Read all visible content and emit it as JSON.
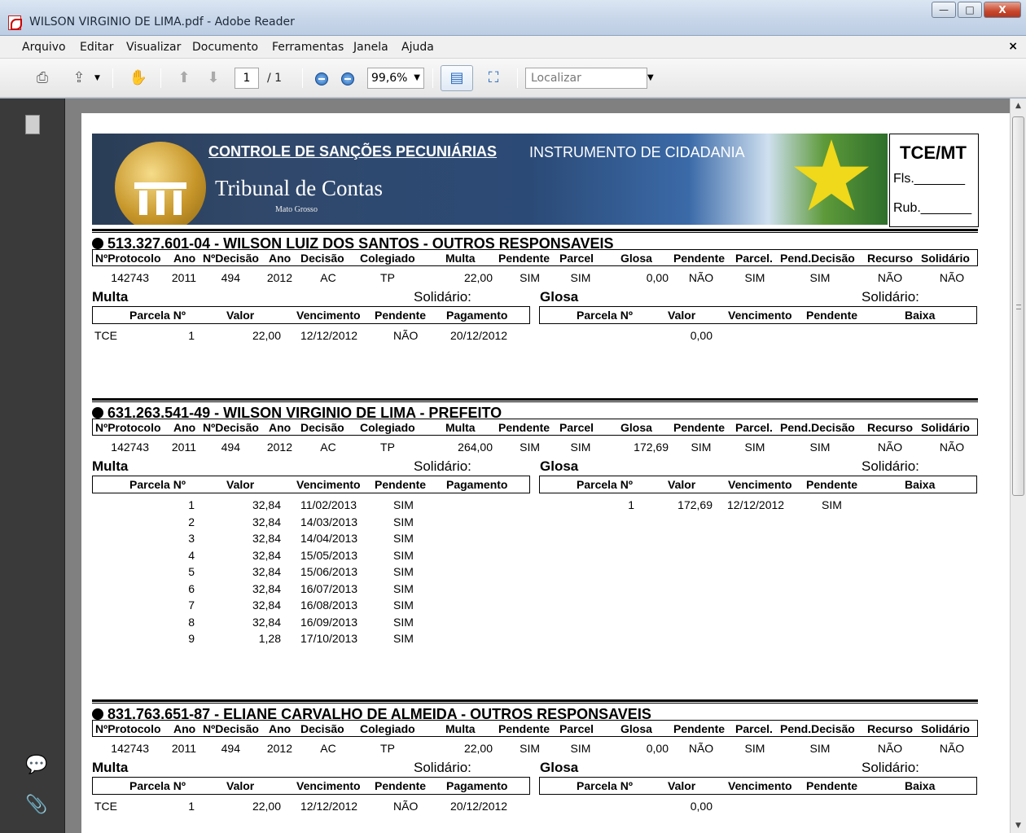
{
  "window": {
    "title": "WILSON VIRGINIO DE LIMA.pdf - Adobe Reader",
    "minimize": "—",
    "maximize": "□",
    "close": "X"
  },
  "menu": [
    "Arquivo",
    "Editar",
    "Visualizar",
    "Documento",
    "Ferramentas",
    "Janela",
    "Ajuda"
  ],
  "menu_close": "×",
  "toolbar": {
    "page_current": "1",
    "page_total": "/ 1",
    "zoom": "99,6%",
    "search_placeholder": "Localizar"
  },
  "banner": {
    "title_underlined": "CONTROLE DE SANÇÕES PECUNIÁRIAS",
    "title_rest": "INSTRUMENTO DE CIDADANIA",
    "org": "Tribunal de Contas",
    "state": "Mato Grosso",
    "box_title": "TCE/MT",
    "box_fls": "Fls._______",
    "box_rub": "Rub._______"
  },
  "labels": {
    "header": [
      "NºProtocolo",
      "Ano",
      "NºDecisão",
      "Ano",
      "Decisão",
      "Colegiado",
      "Multa",
      "Pendente",
      "Parcel",
      "Glosa",
      "Pendente",
      "Parcel.",
      "Pend.Decisão",
      "Recurso",
      "Solidário"
    ],
    "multa": "Multa",
    "glosa": "Glosa",
    "solidario": "Solidário:",
    "multa_sub": [
      "Parcela Nº",
      "Valor",
      "Vencimento",
      "Pendente",
      "Pagamento"
    ],
    "glosa_sub": [
      "Parcela Nº",
      "Valor",
      "Vencimento",
      "Pendente",
      "Baixa"
    ]
  },
  "sections": [
    {
      "heading": "513.327.601-04 - WILSON LUIZ DOS SANTOS - OUTROS RESPONSAVEIS",
      "row": [
        "142743",
        "2011",
        "494",
        "2012",
        "AC",
        "TP",
        "22,00",
        "SIM",
        "SIM",
        "0,00",
        "NÃO",
        "SIM",
        "SIM",
        "NÃO",
        "NÃO"
      ],
      "multa_rows": [
        {
          "tag": "TCE",
          "n": "1",
          "valor": "22,00",
          "venc": "12/12/2012",
          "pend": "NÃO",
          "pag": "20/12/2012"
        }
      ],
      "glosa_rows": [
        {
          "n": "",
          "valor": "0,00",
          "venc": "",
          "pend": ""
        }
      ]
    },
    {
      "heading": "631.263.541-49 - WILSON VIRGINIO DE LIMA - PREFEITO",
      "row": [
        "142743",
        "2011",
        "494",
        "2012",
        "AC",
        "TP",
        "264,00",
        "SIM",
        "SIM",
        "172,69",
        "SIM",
        "SIM",
        "SIM",
        "NÃO",
        "NÃO"
      ],
      "multa_rows": [
        {
          "tag": "",
          "n": "1",
          "valor": "32,84",
          "venc": "11/02/2013",
          "pend": "SIM",
          "pag": ""
        },
        {
          "tag": "",
          "n": "2",
          "valor": "32,84",
          "venc": "14/03/2013",
          "pend": "SIM",
          "pag": ""
        },
        {
          "tag": "",
          "n": "3",
          "valor": "32,84",
          "venc": "14/04/2013",
          "pend": "SIM",
          "pag": ""
        },
        {
          "tag": "",
          "n": "4",
          "valor": "32,84",
          "venc": "15/05/2013",
          "pend": "SIM",
          "pag": ""
        },
        {
          "tag": "",
          "n": "5",
          "valor": "32,84",
          "venc": "15/06/2013",
          "pend": "SIM",
          "pag": ""
        },
        {
          "tag": "",
          "n": "6",
          "valor": "32,84",
          "venc": "16/07/2013",
          "pend": "SIM",
          "pag": ""
        },
        {
          "tag": "",
          "n": "7",
          "valor": "32,84",
          "venc": "16/08/2013",
          "pend": "SIM",
          "pag": ""
        },
        {
          "tag": "",
          "n": "8",
          "valor": "32,84",
          "venc": "16/09/2013",
          "pend": "SIM",
          "pag": ""
        },
        {
          "tag": "",
          "n": "9",
          "valor": "1,28",
          "venc": "17/10/2013",
          "pend": "SIM",
          "pag": ""
        }
      ],
      "glosa_rows": [
        {
          "n": "1",
          "valor": "172,69",
          "venc": "12/12/2012",
          "pend": "SIM"
        }
      ]
    },
    {
      "heading": "831.763.651-87 - ELIANE CARVALHO DE ALMEIDA - OUTROS RESPONSAVEIS",
      "row": [
        "142743",
        "2011",
        "494",
        "2012",
        "AC",
        "TP",
        "22,00",
        "SIM",
        "SIM",
        "0,00",
        "NÃO",
        "SIM",
        "SIM",
        "NÃO",
        "NÃO"
      ],
      "multa_rows": [
        {
          "tag": "TCE",
          "n": "1",
          "valor": "22,00",
          "venc": "12/12/2012",
          "pend": "NÃO",
          "pag": "20/12/2012"
        }
      ],
      "glosa_rows": [
        {
          "n": "",
          "valor": "0,00",
          "venc": "",
          "pend": ""
        }
      ]
    }
  ]
}
